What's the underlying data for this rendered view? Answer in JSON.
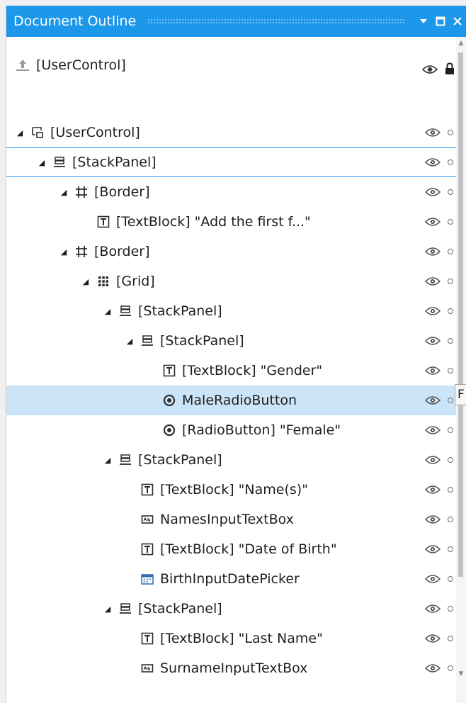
{
  "window": {
    "title": "Document Outline",
    "accent_color": "#1c97ea",
    "selection_color": "#cce4f7"
  },
  "title_buttons": {
    "menu_icon": "dropdown-arrow-icon",
    "maximize_icon": "maximize-icon",
    "close_icon": "close-icon"
  },
  "root_item": {
    "label": "[UserControl]",
    "icon": "scope-up-icon",
    "tools": {
      "visibility_icon": "eye-icon",
      "lock_icon": "lock-icon"
    }
  },
  "tree": {
    "rows": [
      {
        "label": "[UserControl]",
        "icon": "usercontrol-icon",
        "depth": 0,
        "expanded": true,
        "state": "none"
      },
      {
        "label": "[StackPanel]",
        "icon": "stackpanel-icon",
        "depth": 1,
        "expanded": true,
        "state": "outlined"
      },
      {
        "label": "[Border]",
        "icon": "border-icon",
        "depth": 2,
        "expanded": true,
        "state": "none"
      },
      {
        "label": "[TextBlock] \"Add the first f...\"",
        "icon": "textblock-icon",
        "depth": 3,
        "expanded": null,
        "state": "none"
      },
      {
        "label": "[Border]",
        "icon": "border-icon",
        "depth": 2,
        "expanded": true,
        "state": "none"
      },
      {
        "label": "[Grid]",
        "icon": "grid-icon",
        "depth": 3,
        "expanded": true,
        "state": "none"
      },
      {
        "label": "[StackPanel]",
        "icon": "stackpanel-icon",
        "depth": 4,
        "expanded": true,
        "state": "none"
      },
      {
        "label": "[StackPanel]",
        "icon": "stackpanel-icon",
        "depth": 5,
        "expanded": true,
        "state": "none"
      },
      {
        "label": "[TextBlock] \"Gender\"",
        "icon": "textblock-icon",
        "depth": 6,
        "expanded": null,
        "state": "none"
      },
      {
        "label": "MaleRadioButton",
        "icon": "radiobutton-icon",
        "depth": 6,
        "expanded": null,
        "state": "highlighted"
      },
      {
        "label": "[RadioButton] \"Female\"",
        "icon": "radiobutton-icon",
        "depth": 6,
        "expanded": null,
        "state": "none"
      },
      {
        "label": "[StackPanel]",
        "icon": "stackpanel-icon",
        "depth": 4,
        "expanded": true,
        "state": "none"
      },
      {
        "label": "[TextBlock] \"Name(s)\"",
        "icon": "textblock-icon",
        "depth": 5,
        "expanded": null,
        "state": "none"
      },
      {
        "label": "NamesInputTextBox",
        "icon": "textbox-icon",
        "depth": 5,
        "expanded": null,
        "state": "none"
      },
      {
        "label": "[TextBlock] \"Date of Birth\"",
        "icon": "textblock-icon",
        "depth": 5,
        "expanded": null,
        "state": "none"
      },
      {
        "label": "BirthInputDatePicker",
        "icon": "datepicker-icon",
        "depth": 5,
        "expanded": null,
        "state": "none"
      },
      {
        "label": "[StackPanel]",
        "icon": "stackpanel-icon",
        "depth": 4,
        "expanded": true,
        "state": "none"
      },
      {
        "label": "[TextBlock] \"Last Name\"",
        "icon": "textblock-icon",
        "depth": 5,
        "expanded": null,
        "state": "none"
      },
      {
        "label": "SurnameInputTextBox",
        "icon": "textbox-icon",
        "depth": 5,
        "expanded": null,
        "state": "none"
      }
    ],
    "row_tools": {
      "visibility_icon": "eye-icon",
      "lock_icon": "unlocked-dot-icon"
    }
  },
  "tooltip_partial": "F",
  "scrollbar": {
    "up_icon": "scroll-up-icon",
    "down_icon": "scroll-down-icon"
  }
}
